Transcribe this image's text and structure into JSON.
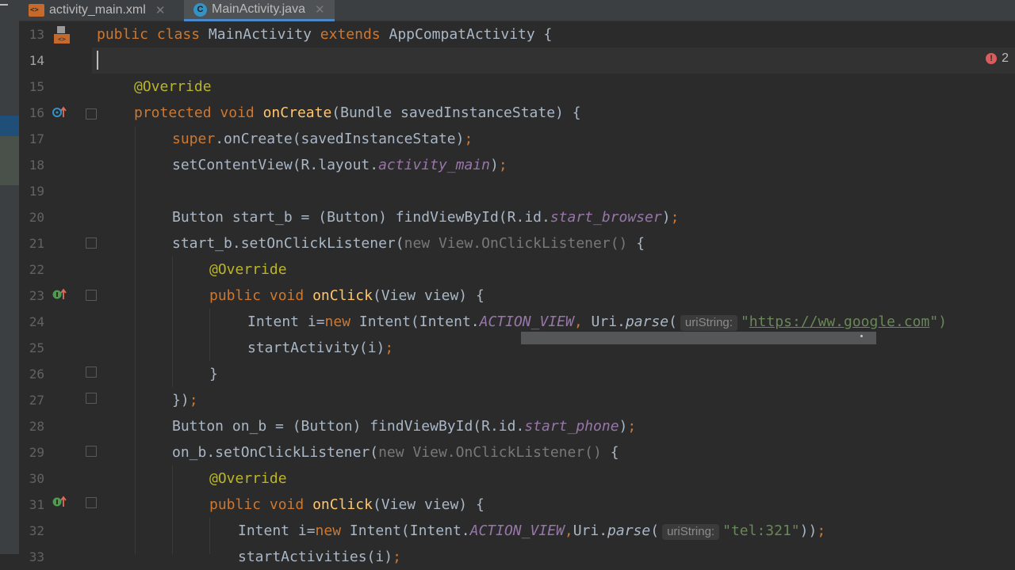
{
  "tabs": [
    {
      "label": "activity_main.xml",
      "icon": "xml-layout-icon",
      "active": false
    },
    {
      "label": "MainActivity.java",
      "icon": "java-class-icon",
      "active": true
    }
  ],
  "problems": {
    "errors": "2"
  },
  "line_numbers": [
    "13",
    "14",
    "15",
    "16",
    "17",
    "18",
    "19",
    "20",
    "21",
    "22",
    "23",
    "24",
    "25",
    "26",
    "27",
    "28",
    "29",
    "30",
    "31",
    "32",
    "33"
  ],
  "code": {
    "l13": {
      "a": "public",
      "b": " ",
      "c": "class",
      "d": " MainActivity ",
      "e": "extends",
      "f": " AppCompatActivity {"
    },
    "l15": {
      "a": "@Override"
    },
    "l16": {
      "a": "protected",
      "b": " ",
      "c": "void",
      "d": " ",
      "e": "onCreate",
      "f": "(Bundle savedInstanceState) {"
    },
    "l17": {
      "a": "super",
      "b": ".onCreate(savedInstanceState)",
      "c": ";"
    },
    "l18": {
      "a": "setContentView(R.layout.",
      "b": "activity_main",
      "c": ")",
      "d": ";"
    },
    "l20": {
      "a": "Button start_b = (Button) findViewById(R.id.",
      "b": "start_browser",
      "c": ")",
      "d": ";"
    },
    "l21": {
      "a": "start_b.setOnClickListener(",
      "b": "new View.OnClickListener()",
      "c": " {"
    },
    "l22": {
      "a": "@Override"
    },
    "l23": {
      "a": "public",
      "b": " ",
      "c": "void",
      "d": " ",
      "e": "onClick",
      "f": "(View view) {"
    },
    "l24": {
      "a": "Intent i=",
      "b": "new",
      "c": " Intent(Intent.",
      "d": "ACTION_VIEW",
      "e": ",",
      "f": " Uri.",
      "g": "parse",
      "h": "(",
      "hint": "uriString:",
      "q1": "\"",
      "url": "https://ww.google.com",
      "q2": "\")"
    },
    "l25": {
      "a": "startActivity(i)",
      "b": ";"
    },
    "l26": {
      "a": "}"
    },
    "l27": {
      "a": "})",
      "b": ";"
    },
    "l28": {
      "a": "Button on_b = (Button) findViewById(R.id.",
      "b": "start_phone",
      "c": ")",
      "d": ";"
    },
    "l29": {
      "a": "on_b.setOnClickListener(",
      "b": "new View.OnClickListener()",
      "c": " {"
    },
    "l30": {
      "a": "@Override"
    },
    "l31": {
      "a": "public",
      "b": " ",
      "c": "void",
      "d": " ",
      "e": "onClick",
      "f": "(View view) {"
    },
    "l32": {
      "a": "Intent i=",
      "b": "new",
      "c": " Intent(Intent.",
      "d": "ACTION_VIEW",
      "e": ",",
      "f": "Uri.",
      "g": "parse",
      "h": "(",
      "hint": "uriString:",
      "s": "\"tel:321\"",
      "i": "))",
      "j": ";"
    },
    "l33": {
      "a": "startActivities(i)",
      "b": ";"
    }
  },
  "colors": {
    "keyword": "#cc7832",
    "annotation": "#bbb529",
    "method": "#ffc66d",
    "static_field": "#9876aa",
    "string": "#6a8759",
    "text": "#a9b7c6"
  }
}
